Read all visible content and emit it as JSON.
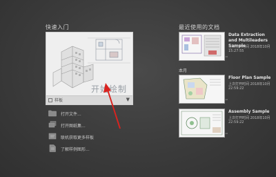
{
  "quick_start": {
    "title": "快速入门",
    "start_drawing_label": "开始绘制",
    "template_label": "样板",
    "links": [
      {
        "label": "打开文件...",
        "icon": "folder-icon"
      },
      {
        "label": "打开图纸集...",
        "icon": "sheet-set-icon"
      },
      {
        "label": "联机获取更多样板",
        "icon": "online-template-icon"
      },
      {
        "label": "了解样例图形...",
        "icon": "sample-drawing-icon"
      }
    ]
  },
  "recent": {
    "title": "最近使用的文档",
    "group_label": "本月",
    "items": [
      {
        "name": "Data Extraction and Multileaders Sample",
        "meta_1": "上次打开时间 2018年10月",
        "meta_2": "15:27:55"
      },
      {
        "name": "Floor Plan Sample",
        "meta_1": "上次打开时间 2018年10月",
        "meta_2": "22:59:22"
      },
      {
        "name": "Assembly Sample",
        "meta_1": "上次打开时间 2018年10月",
        "meta_2": "22:59:22"
      }
    ]
  },
  "colors": {
    "background": "#3a3a3a",
    "annotation_arrow": "#d9231f"
  }
}
